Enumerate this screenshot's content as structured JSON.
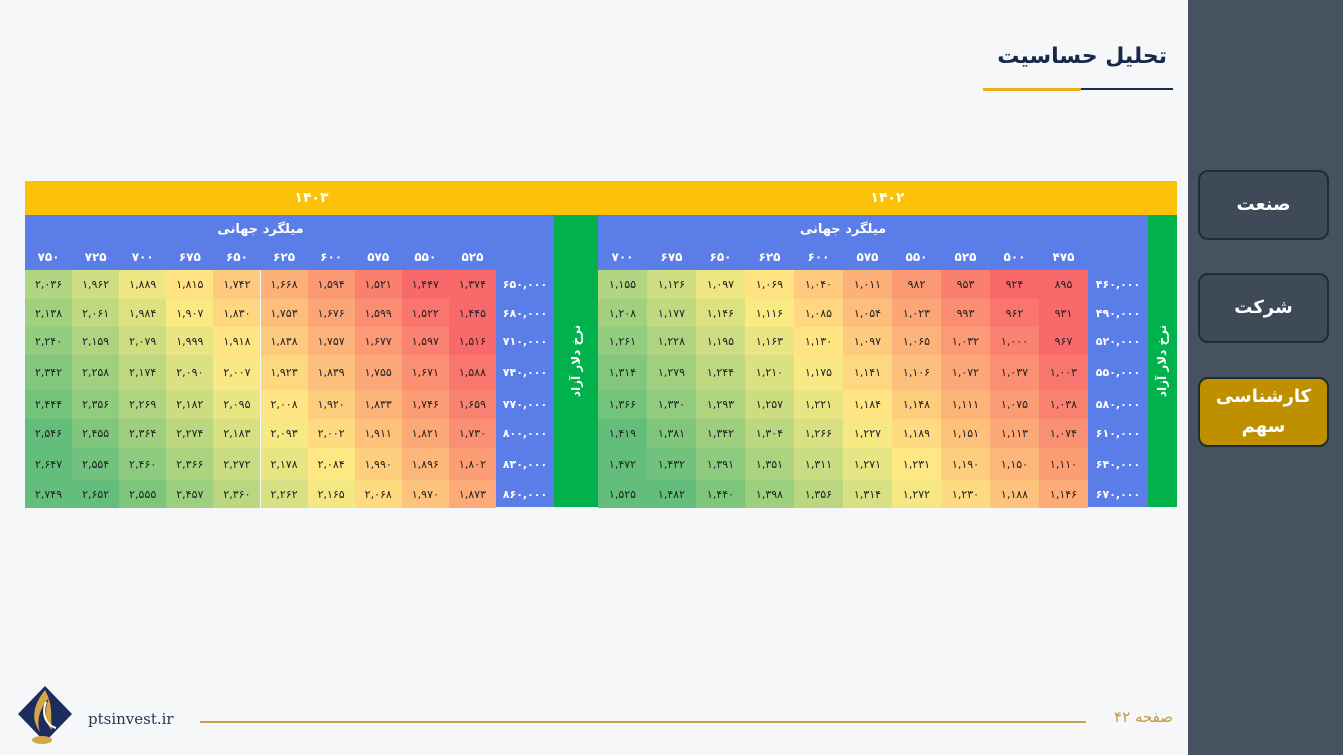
{
  "title": "تحلیل حساسیت",
  "nav": [
    "صنعت",
    "شرکت",
    "کارشناسی سهم"
  ],
  "footer": {
    "page": "صفحه ۴۲",
    "site": "ptsinvest.ir"
  },
  "colors": {
    "accent": "#fcc20a",
    "header_blue": "#5a7de8",
    "green": "#00b14c",
    "active_nav": "#be9000"
  },
  "tables": [
    {
      "year": "۱۴۰۲",
      "metal_label": "میلگرد جهانی",
      "rate_label": "نرخ دلار آزاد",
      "cols": [
        "۴۷۵",
        "۵۰۰",
        "۵۲۵",
        "۵۵۰",
        "۵۷۵",
        "۶۰۰",
        "۶۲۵",
        "۶۵۰",
        "۶۷۵",
        "۷۰۰"
      ],
      "rows": [
        "۴۶۰,۰۰۰",
        "۴۹۰,۰۰۰",
        "۵۲۰,۰۰۰",
        "۵۵۰,۰۰۰",
        "۵۸۰,۰۰۰",
        "۶۱۰,۰۰۰",
        "۶۴۰,۰۰۰",
        "۶۷۰,۰۰۰"
      ],
      "cells": [
        [
          "۸۹۵",
          "۹۲۴",
          "۹۵۳",
          "۹۸۲",
          "۱,۰۱۱",
          "۱,۰۴۰",
          "۱,۰۶۹",
          "۱,۰۹۷",
          "۱,۱۲۶",
          "۱,۱۵۵"
        ],
        [
          "۹۳۱",
          "۹۶۲",
          "۹۹۳",
          "۱,۰۲۳",
          "۱,۰۵۴",
          "۱,۰۸۵",
          "۱,۱۱۶",
          "۱,۱۴۶",
          "۱,۱۷۷",
          "۱,۲۰۸"
        ],
        [
          "۹۶۷",
          "۱,۰۰۰",
          "۱,۰۳۲",
          "۱,۰۶۵",
          "۱,۰۹۷",
          "۱,۱۳۰",
          "۱,۱۶۳",
          "۱,۱۹۵",
          "۱,۲۲۸",
          "۱,۲۶۱"
        ],
        [
          "۱,۰۰۳",
          "۱,۰۳۷",
          "۱,۰۷۲",
          "۱,۱۰۶",
          "۱,۱۴۱",
          "۱,۱۷۵",
          "۱,۲۱۰",
          "۱,۲۴۴",
          "۱,۲۷۹",
          "۱,۳۱۴"
        ],
        [
          "۱,۰۳۸",
          "۱,۰۷۵",
          "۱,۱۱۱",
          "۱,۱۴۸",
          "۱,۱۸۴",
          "۱,۲۲۱",
          "۱,۲۵۷",
          "۱,۲۹۳",
          "۱,۳۳۰",
          "۱,۳۶۶"
        ],
        [
          "۱,۰۷۴",
          "۱,۱۱۳",
          "۱,۱۵۱",
          "۱,۱۸۹",
          "۱,۲۲۷",
          "۱,۲۶۶",
          "۱,۳۰۴",
          "۱,۳۴۲",
          "۱,۳۸۱",
          "۱,۴۱۹"
        ],
        [
          "۱,۱۱۰",
          "۱,۱۵۰",
          "۱,۱۹۰",
          "۱,۲۳۱",
          "۱,۲۷۱",
          "۱,۳۱۱",
          "۱,۳۵۱",
          "۱,۳۹۱",
          "۱,۴۳۲",
          "۱,۴۷۲"
        ],
        [
          "۱,۱۴۶",
          "۱,۱۸۸",
          "۱,۲۳۰",
          "۱,۲۷۲",
          "۱,۳۱۴",
          "۱,۳۵۶",
          "۱,۳۹۸",
          "۱,۴۴۰",
          "۱,۴۸۲",
          "۱,۵۲۵"
        ]
      ]
    },
    {
      "year": "۱۴۰۳",
      "metal_label": "میلگرد جهانی",
      "rate_label": "نرخ دلار آزاد",
      "cols": [
        "۵۲۵",
        "۵۵۰",
        "۵۷۵",
        "۶۰۰",
        "۶۲۵",
        "۶۵۰",
        "۶۷۵",
        "۷۰۰",
        "۷۲۵",
        "۷۵۰"
      ],
      "rows": [
        "۶۵۰,۰۰۰",
        "۶۸۰,۰۰۰",
        "۷۱۰,۰۰۰",
        "۷۴۰,۰۰۰",
        "۷۷۰,۰۰۰",
        "۸۰۰,۰۰۰",
        "۸۳۰,۰۰۰",
        "۸۶۰,۰۰۰"
      ],
      "cells": [
        [
          "۱,۳۷۴",
          "۱,۴۴۷",
          "۱,۵۲۱",
          "۱,۵۹۴",
          "۱,۶۶۸",
          "۱,۷۴۲",
          "۱,۸۱۵",
          "۱,۸۸۹",
          "۱,۹۶۲",
          "۲,۰۳۶"
        ],
        [
          "۱,۴۴۵",
          "۱,۵۲۲",
          "۱,۵۹۹",
          "۱,۶۷۶",
          "۱,۷۵۳",
          "۱,۸۳۰",
          "۱,۹۰۷",
          "۱,۹۸۴",
          "۲,۰۶۱",
          "۲,۱۳۸"
        ],
        [
          "۱,۵۱۶",
          "۱,۵۹۷",
          "۱,۶۷۷",
          "۱,۷۵۷",
          "۱,۸۳۸",
          "۱,۹۱۸",
          "۱,۹۹۹",
          "۲,۰۷۹",
          "۲,۱۵۹",
          "۲,۲۴۰"
        ],
        [
          "۱,۵۸۸",
          "۱,۶۷۱",
          "۱,۷۵۵",
          "۱,۸۳۹",
          "۱,۹۲۳",
          "۲,۰۰۷",
          "۲,۰۹۰",
          "۲,۱۷۴",
          "۲,۲۵۸",
          "۲,۳۴۲"
        ],
        [
          "۱,۶۵۹",
          "۱,۷۴۶",
          "۱,۸۳۳",
          "۱,۹۲۰",
          "۲,۰۰۸",
          "۲,۰۹۵",
          "۲,۱۸۲",
          "۲,۲۶۹",
          "۲,۳۵۶",
          "۲,۴۴۴"
        ],
        [
          "۱,۷۳۰",
          "۱,۸۲۱",
          "۱,۹۱۱",
          "۲,۰۰۲",
          "۲,۰۹۳",
          "۲,۱۸۳",
          "۲,۲۷۴",
          "۲,۳۶۴",
          "۲,۴۵۵",
          "۲,۵۴۶"
        ],
        [
          "۱,۸۰۲",
          "۱,۸۹۶",
          "۱,۹۹۰",
          "۲,۰۸۴",
          "۲,۱۷۸",
          "۲,۲۷۲",
          "۲,۳۶۶",
          "۲,۴۶۰",
          "۲,۵۵۴",
          "۲,۶۴۷"
        ],
        [
          "۱,۸۷۳",
          "۱,۹۷۰",
          "۲,۰۶۸",
          "۲,۱۶۵",
          "۲,۲۶۲",
          "۲,۳۶۰",
          "۲,۴۵۷",
          "۲,۵۵۵",
          "۲,۶۵۲",
          "۲,۷۴۹"
        ]
      ]
    }
  ]
}
